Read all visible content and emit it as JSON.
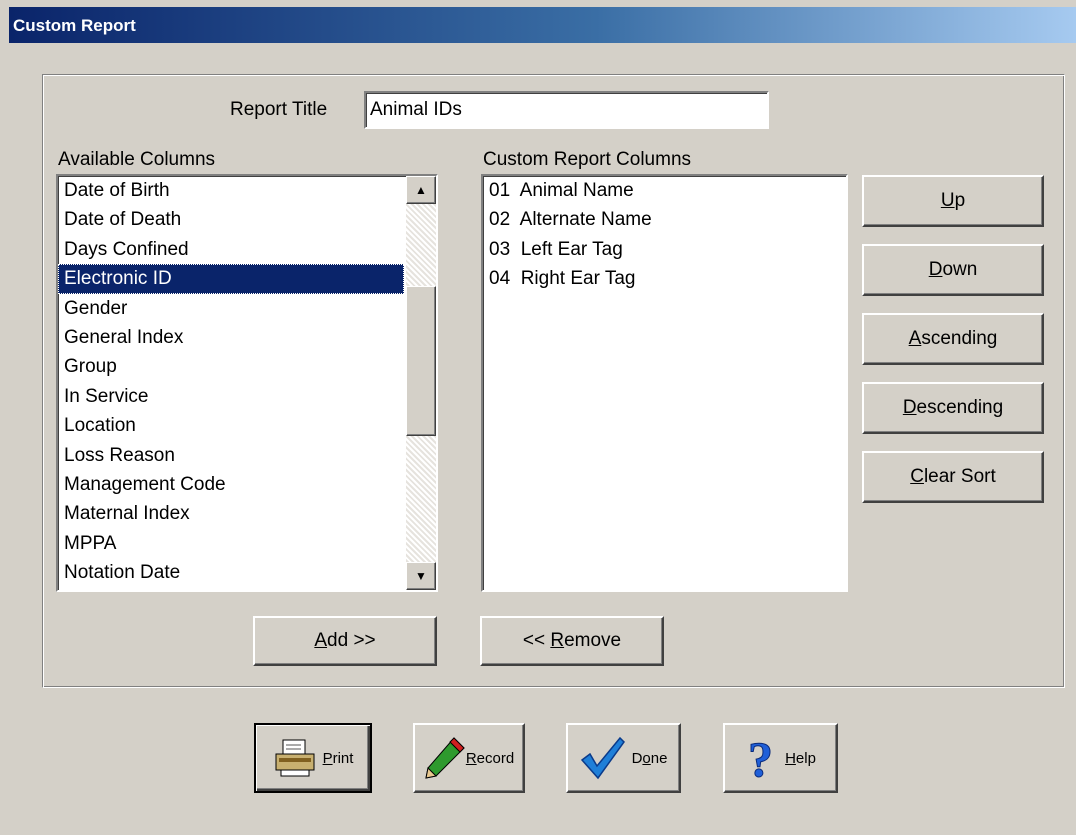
{
  "window": {
    "title": "Custom Report"
  },
  "report_title": {
    "label": "Report Title",
    "value": "Animal IDs"
  },
  "available": {
    "label": "Available Columns",
    "items": [
      "Date of Birth",
      "Date of Death",
      "Days Confined",
      "Electronic ID",
      "Gender",
      "General Index",
      "Group",
      "In Service",
      "Location",
      "Loss Reason",
      "Management Code",
      "Maternal Index",
      "MPPA",
      "Notation Date"
    ],
    "selected": "Electronic ID"
  },
  "custom": {
    "label": "Custom Report Columns",
    "items": [
      "01  Animal Name",
      "02  Alternate Name",
      "03  Left Ear Tag",
      "04  Right Ear Tag"
    ]
  },
  "side_buttons": {
    "up": {
      "key": "U",
      "rest": "p"
    },
    "down": {
      "key": "D",
      "rest": "own"
    },
    "ascending": {
      "key": "A",
      "rest": "scending"
    },
    "descending": {
      "key": "D",
      "rest": "escending"
    },
    "clear_sort": {
      "key": "C",
      "rest": "lear Sort"
    }
  },
  "add_button": {
    "key": "A",
    "rest": "dd >>"
  },
  "remove_button": {
    "prefix": "<< ",
    "key": "R",
    "rest": "emove"
  },
  "bottom": {
    "print": {
      "key": "P",
      "rest": "rint",
      "icon": "printer-icon"
    },
    "record": {
      "key": "R",
      "rest": "ecord",
      "icon": "pencil-icon"
    },
    "done": {
      "pre": "D",
      "key": "o",
      "rest": "ne",
      "icon": "checkmark-icon"
    },
    "help": {
      "key": "H",
      "rest": "elp",
      "icon": "question-icon"
    }
  },
  "colors": {
    "title_bar": "#0a246a",
    "selection": "#0a246a",
    "face": "#d4d0c8"
  }
}
